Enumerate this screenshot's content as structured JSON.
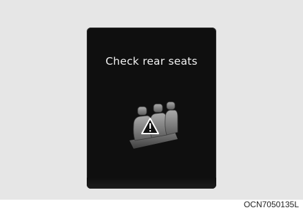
{
  "display": {
    "message": "Check rear seats",
    "icon": "rear-seat-warning-icon"
  },
  "figure_code": "OCN7050135L",
  "colors": {
    "background": "#e6e6e6",
    "screen": "#0f0f0f",
    "text": "#f2f2f2",
    "seat": "#8a8a8a"
  }
}
